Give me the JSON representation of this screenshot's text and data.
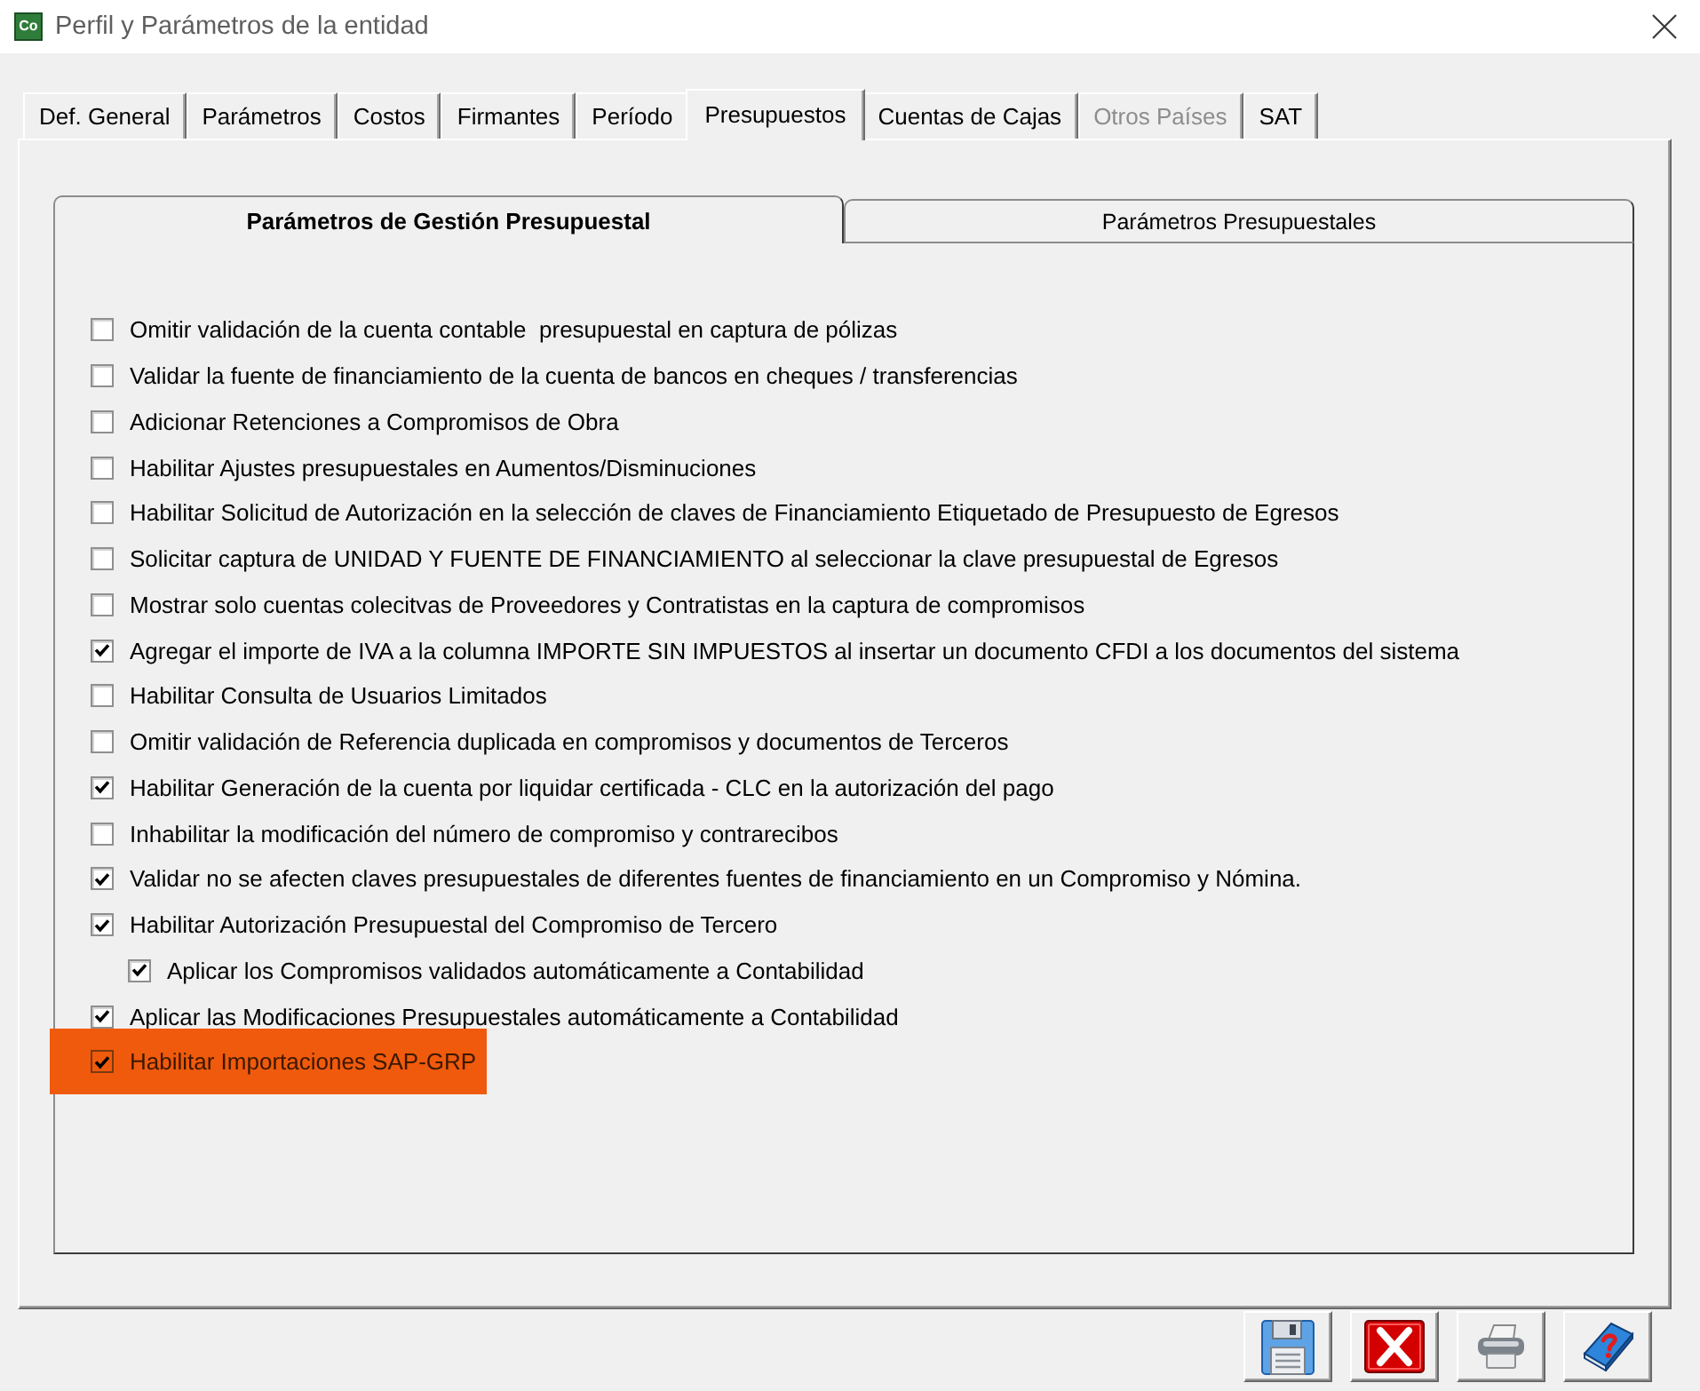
{
  "window": {
    "app_icon_label": "Co",
    "title": "Perfil y Parámetros de la entidad"
  },
  "tabs": [
    {
      "label": "Def. General",
      "selected": false,
      "disabled": false
    },
    {
      "label": "Parámetros",
      "selected": false,
      "disabled": false
    },
    {
      "label": "Costos",
      "selected": false,
      "disabled": false
    },
    {
      "label": "Firmantes",
      "selected": false,
      "disabled": false
    },
    {
      "label": "Período",
      "selected": false,
      "disabled": false
    },
    {
      "label": "Presupuestos",
      "selected": true,
      "disabled": false
    },
    {
      "label": "Cuentas de Cajas",
      "selected": false,
      "disabled": false
    },
    {
      "label": "Otros Países",
      "selected": false,
      "disabled": true
    },
    {
      "label": "SAT",
      "selected": false,
      "disabled": false
    }
  ],
  "subtabs": [
    {
      "label": "Parámetros de Gestión Presupuestal",
      "selected": true
    },
    {
      "label": "Parámetros Presupuestales",
      "selected": false
    }
  ],
  "options": [
    {
      "label": "Omitir validación de la cuenta contable  presupuestal en captura de pólizas",
      "checked": false,
      "highlighted": false
    },
    {
      "label": "Validar la fuente de financiamiento de la cuenta de bancos en cheques / transferencias",
      "checked": false,
      "highlighted": false
    },
    {
      "label": "Adicionar Retenciones a Compromisos de Obra",
      "checked": false,
      "highlighted": false
    },
    {
      "label": "Habilitar Ajustes presupuestales en Aumentos/Disminuciones",
      "checked": false,
      "highlighted": false
    },
    {
      "label": "Habilitar Solicitud de Autorización en la selección de claves de Financiamiento Etiquetado de Presupuesto de Egresos",
      "checked": false,
      "highlighted": false
    },
    {
      "label": "Solicitar captura de UNIDAD Y FUENTE DE FINANCIAMIENTO al seleccionar la clave presupuestal de Egresos",
      "checked": false,
      "highlighted": false
    },
    {
      "label": "Mostrar solo cuentas colecitvas de Proveedores y Contratistas en la captura de compromisos",
      "checked": false,
      "highlighted": false
    },
    {
      "label": "Agregar el importe de IVA a la columna IMPORTE SIN IMPUESTOS al insertar un documento CFDI a los documentos del sistema",
      "checked": true,
      "highlighted": false
    },
    {
      "label": "Habilitar Consulta de Usuarios Limitados",
      "checked": false,
      "highlighted": false
    },
    {
      "label": "Omitir validación de Referencia duplicada en compromisos y documentos de Terceros",
      "checked": false,
      "highlighted": false
    },
    {
      "label": "Habilitar Generación de la cuenta por liquidar certificada - CLC en la autorización del pago",
      "checked": true,
      "highlighted": false
    },
    {
      "label": "Inhabilitar la modificación del número de compromiso y contrarecibos",
      "checked": false,
      "highlighted": false
    },
    {
      "label": "Validar no se afecten claves presupuestales de diferentes fuentes de financiamiento en un Compromiso y Nómina.",
      "checked": true,
      "highlighted": false
    },
    {
      "label": "Habilitar Autorización Presupuestal del Compromiso de Tercero",
      "checked": true,
      "highlighted": false,
      "children": [
        {
          "label": "Aplicar los Compromisos validados automáticamente a Contabilidad",
          "checked": true,
          "highlighted": false
        }
      ]
    },
    {
      "label": "Aplicar las Modificaciones Presupuestales automáticamente a Contabilidad",
      "checked": true,
      "highlighted": false
    },
    {
      "label": "Habilitar Importaciones SAP-GRP",
      "checked": true,
      "highlighted": true
    }
  ],
  "toolbar": [
    {
      "kind": "save"
    },
    {
      "kind": "cancel"
    },
    {
      "kind": "print"
    },
    {
      "kind": "help"
    }
  ]
}
